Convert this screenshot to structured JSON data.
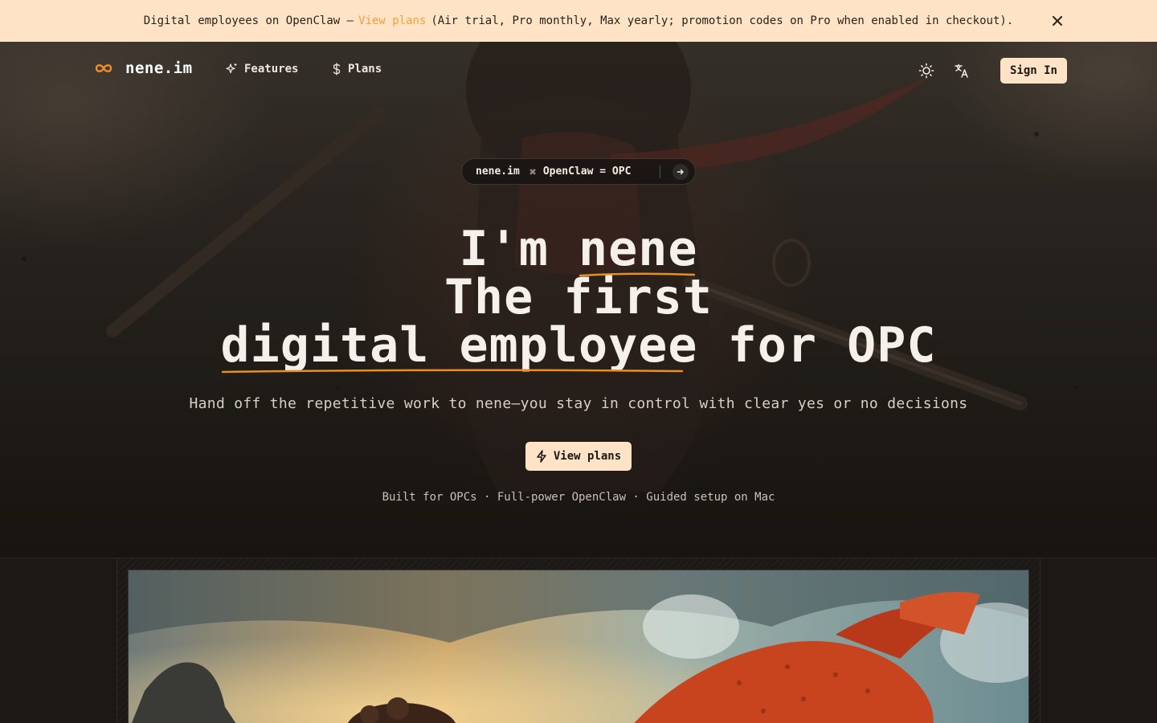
{
  "announcement": {
    "prefix": "Digital employees on OpenClaw —",
    "link": "View plans",
    "suffix": "(Air trial, Pro monthly, Max yearly; promotion codes on Pro when enabled in checkout).",
    "close_icon": "close-icon"
  },
  "nav": {
    "logo_text": "nene.im",
    "logo_icon": "infinity-icon",
    "items": [
      {
        "label": "Features",
        "icon": "sparkles-icon"
      },
      {
        "label": "Plans",
        "icon": "dollar-icon"
      }
    ],
    "theme_icon": "sun-icon",
    "language_icon": "translate-icon",
    "signin_label": "Sign In"
  },
  "pill": {
    "left": "nene.im",
    "times": "✖",
    "right": "OpenClaw = OPC",
    "arrow_icon": "arrow-right-icon"
  },
  "hero": {
    "line1_a": "I'm",
    "line1_b": "nene",
    "line2": "The first",
    "line3_a": "digital employee",
    "line3_b": "for OPC",
    "subtitle": "Hand off the repetitive work to nene—you stay in control with clear yes or no decisions",
    "cta_label": "View plans",
    "cta_icon": "lightning-icon",
    "features_line": "Built for OPCs · Full-power OpenClaw · Guided setup on Mac"
  },
  "colors": {
    "accent": "#f0a23a",
    "cream": "#ffe3c7",
    "underline": "#e8901f"
  }
}
